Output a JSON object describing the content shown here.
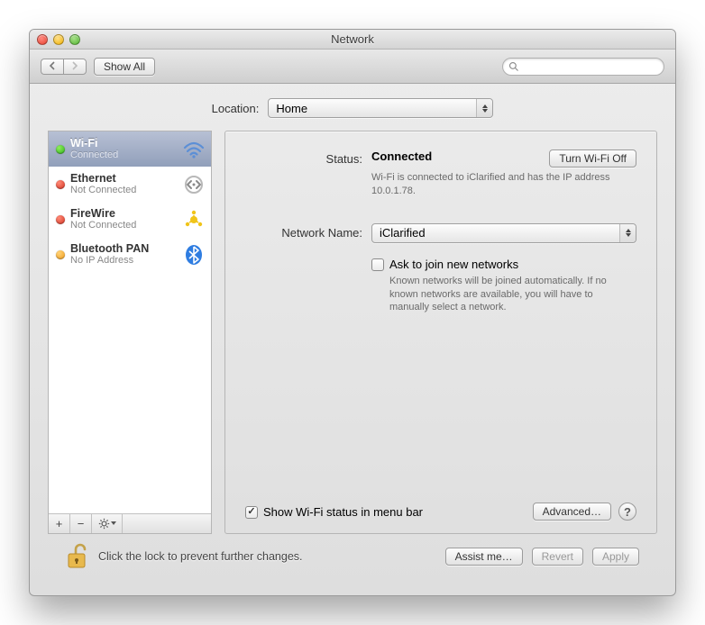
{
  "window": {
    "title": "Network"
  },
  "toolbar": {
    "show_all": "Show All",
    "search_placeholder": ""
  },
  "location": {
    "label": "Location:",
    "selected": "Home"
  },
  "services": [
    {
      "name": "Wi-Fi",
      "sub": "Connected",
      "status": "green",
      "icon": "wifi",
      "selected": true
    },
    {
      "name": "Ethernet",
      "sub": "Not Connected",
      "status": "red",
      "icon": "ethernet",
      "selected": false
    },
    {
      "name": "FireWire",
      "sub": "Not Connected",
      "status": "red",
      "icon": "firewire",
      "selected": false
    },
    {
      "name": "Bluetooth PAN",
      "sub": "No IP Address",
      "status": "orange",
      "icon": "bluetooth",
      "selected": false
    }
  ],
  "main": {
    "status_label": "Status:",
    "status_value": "Connected",
    "turn_off": "Turn Wi-Fi Off",
    "status_desc": "Wi-Fi is connected to iClarified and has the IP address 10.0.1.78.",
    "network_label": "Network Name:",
    "network_selected": "iClarified",
    "ask_join": "Ask to join new networks",
    "ask_desc": "Known networks will be joined automatically. If no known networks are available, you will have to manually select a network.",
    "show_menubar": "Show Wi-Fi status in menu bar",
    "advanced": "Advanced…"
  },
  "footer": {
    "lock_text": "Click the lock to prevent further changes.",
    "assist": "Assist me…",
    "revert": "Revert",
    "apply": "Apply"
  }
}
